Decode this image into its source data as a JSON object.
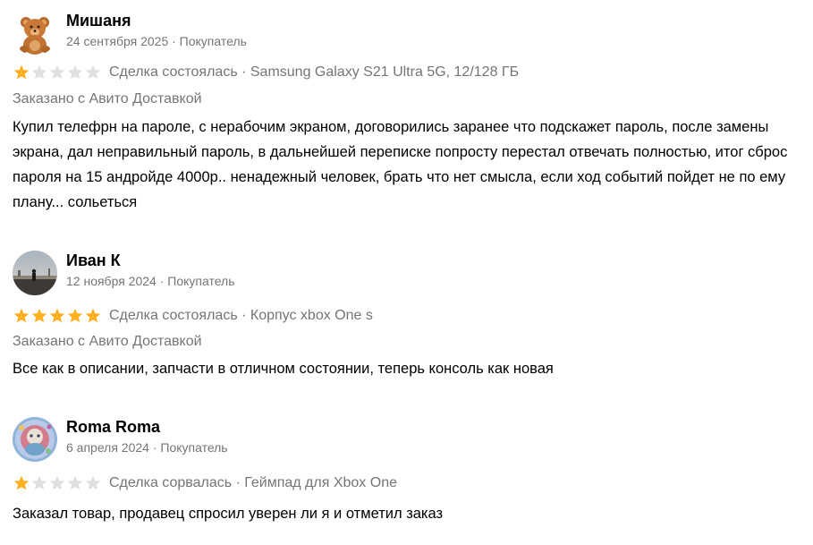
{
  "reviews": [
    {
      "author": "Мишаня",
      "avatar": "teddy-bear-avatar",
      "meta": "24 сентября 2025 · Покупатель",
      "rating": 1,
      "deal": "Сделка состоялась · Samsung Galaxy S21 Ultra 5G, 12/128 ГБ",
      "delivery": "Заказано с Авито Доставкой",
      "text": "Купил телефрн на пароле, с нерабочим экраном, договорились заранее что подскажет пароль, после замены экрана, дал неправильный пароль, в дальнейшей переписке попросту перестал отвечать полностью, итог сброс пароля на 15 андройде 4000р.. ненадежный человек, брать что нет смысла, если ход событий пойдет не по ему плану... сольеться"
    },
    {
      "author": "Иван К",
      "avatar": "landscape-photo-avatar",
      "meta": "12 ноября 2024 · Покупатель",
      "rating": 5,
      "deal": "Сделка состоялась · Корпус xbox One s",
      "delivery": "Заказано с Авито Доставкой",
      "text": "Все как в описании, запчасти в отличном состоянии, теперь консоль как новая"
    },
    {
      "author": "Roma Roma",
      "avatar": "colorful-art-avatar",
      "meta": "6 апреля 2024 · Покупатель",
      "rating": 1,
      "deal": "Сделка сорвалась · Геймпад для Xbox One",
      "delivery": "",
      "text": "Заказал товар, продавец спросил уверен ли я и отметил заказ"
    }
  ],
  "colors": {
    "star_filled": "#FFB021",
    "star_empty": "#E0E0E0",
    "muted_text": "#757575"
  }
}
